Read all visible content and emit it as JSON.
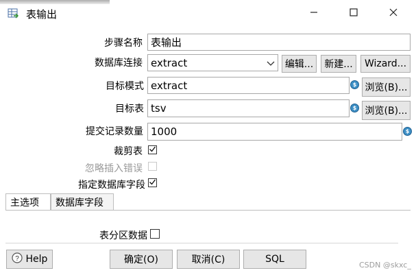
{
  "window": {
    "title": "表输出",
    "app_icon": "table-output-icon",
    "controls": {
      "minimize": "minimize-icon",
      "maximize": "maximize-icon",
      "close": "close-icon"
    }
  },
  "form": {
    "step_name": {
      "label": "步骤名称",
      "value": "表输出"
    },
    "db_connection": {
      "label": "数据库连接",
      "value": "extract",
      "edit": "编辑...",
      "new": "新建...",
      "wizard": "Wizard..."
    },
    "target_schema": {
      "label": "目标模式",
      "value": "extract",
      "browse": "浏览(B)..."
    },
    "target_table": {
      "label": "目标表",
      "value": "tsv",
      "browse": "浏览(B)..."
    },
    "commit_size": {
      "label": "提交记录数量",
      "value": "1000"
    },
    "truncate_table": {
      "label": "裁剪表",
      "checked": true
    },
    "ignore_insert_errors": {
      "label": "忽略插入错误",
      "checked": false,
      "disabled": true
    },
    "specify_db_fields": {
      "label": "指定数据库字段",
      "checked": true
    }
  },
  "tabs": [
    {
      "label": "主选项",
      "active": true
    },
    {
      "label": "数据库字段",
      "active": false
    }
  ],
  "main_tab": {
    "partition_label": "表分区数据",
    "partition_checked": false
  },
  "footer": {
    "help": "Help",
    "ok": "确定(O)",
    "cancel": "取消(C)",
    "sql": "SQL"
  },
  "watermark": "CSDN @skxc_"
}
